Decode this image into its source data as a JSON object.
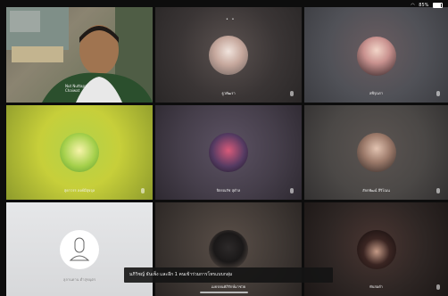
{
  "status_bar": {
    "battery": "85%"
  },
  "participants": [
    {
      "name": "Nut Nuttapat\nChaiwat",
      "bg": "#5d6b4f",
      "accent": "#b9a37a"
    },
    {
      "name": "ธูวพัฒรา",
      "bg": "#3a3535",
      "accent": "#6a5f5c"
    },
    {
      "name": "ลพีรุณรา",
      "bg": "#505157",
      "accent": "#8a6e72"
    },
    {
      "name": "สุดาวรร ลงค์มีสุจจุล",
      "bg": "#c7cf3a",
      "accent": "#88b83d"
    },
    {
      "name": "จิตรณรัช สุดำล",
      "bg": "#453e4a",
      "accent": "#6c5e73"
    },
    {
      "name": "สัจกพัฒน์ ลีริโณน",
      "bg": "#4b4846",
      "accent": "#6a5b52"
    },
    {
      "name": "ลุลานดาน ต่ำสุขนุตร",
      "bg": "#d7d8da",
      "accent": "#ececee"
    },
    {
      "name": "เมธรยนคัภิรักษ์มาช่วย",
      "bg": "#403935",
      "accent": "#7a6a62"
    },
    {
      "name": "ทับสอดำ",
      "bg": "#2e2624",
      "accent": "#5b3a33"
    }
  ],
  "toast": "มภิวิชญ์ ธันเพ็ง และอีก 1 คนเข้าร่วมการโทรแบบกลุ่ม"
}
